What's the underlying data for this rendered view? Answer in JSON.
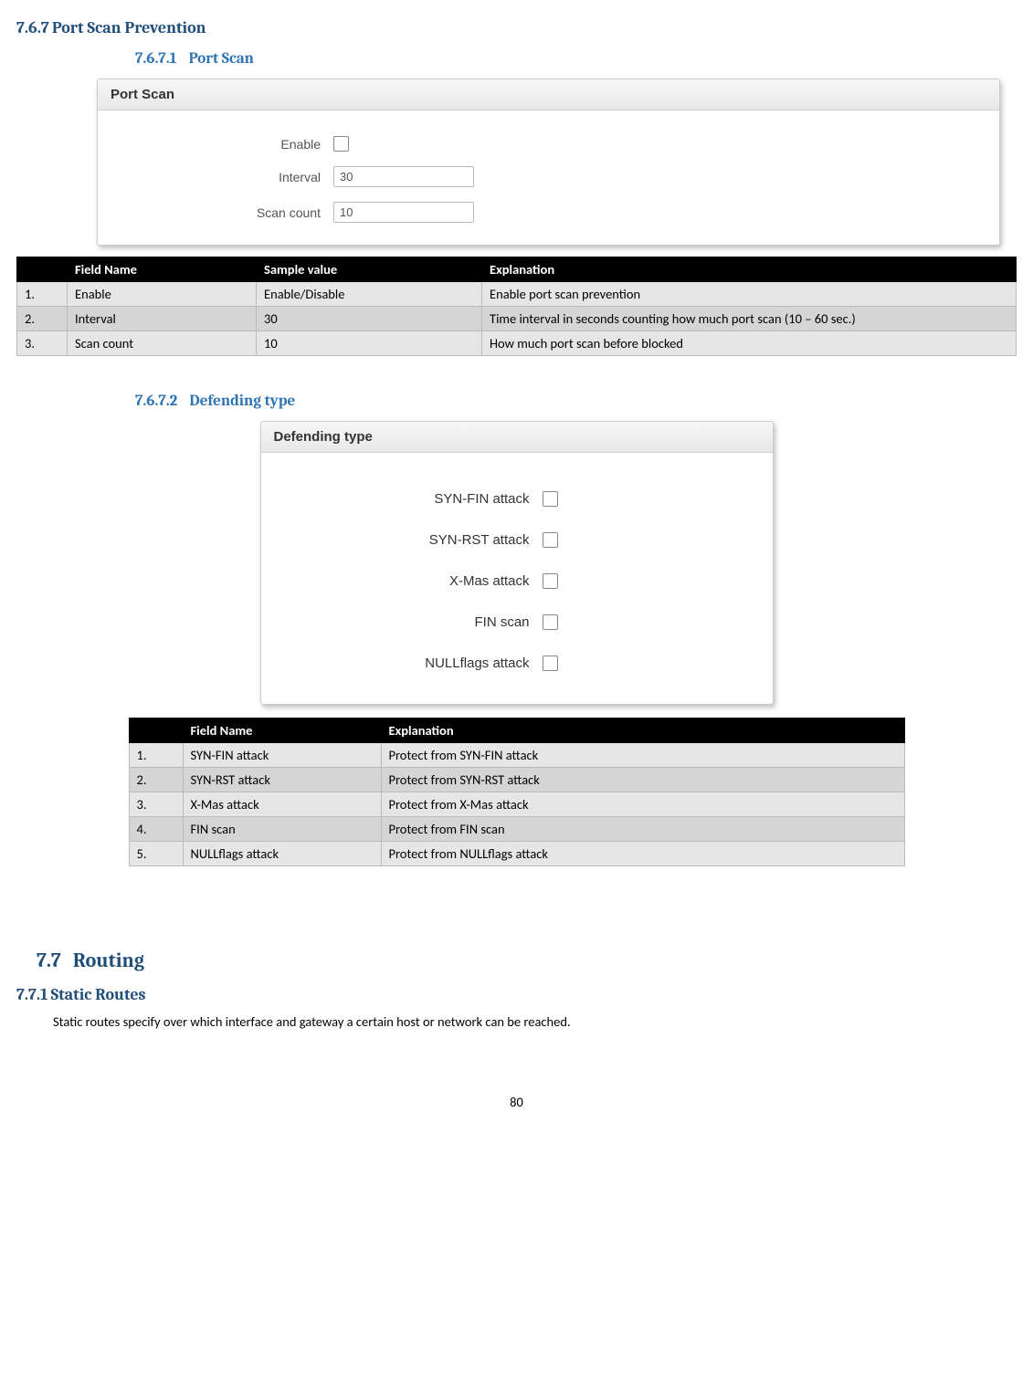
{
  "sections": {
    "s767_num": "7.6.7",
    "s767_title": "Port Scan Prevention",
    "s7671_num": "7.6.7.1",
    "s7671_title": "Port Scan",
    "s7672_num": "7.6.7.2",
    "s7672_title": "Defending type",
    "s77_num": "7.7",
    "s77_title": "Routing",
    "s771_num": "7.7.1",
    "s771_title": "Static Routes"
  },
  "portscan_panel": {
    "title": "Port Scan",
    "enable_label": "Enable",
    "interval_label": "Interval",
    "interval_value": "30",
    "scancount_label": "Scan count",
    "scancount_value": "10"
  },
  "table1": {
    "h_num": "",
    "h_field": "Field Name",
    "h_sample": "Sample value",
    "h_expl": "Explanation",
    "rows": [
      {
        "n": "1.",
        "field": "Enable",
        "sample": "Enable/Disable",
        "expl": "Enable port scan prevention"
      },
      {
        "n": "2.",
        "field": "Interval",
        "sample": "30",
        "expl": "Time interval in seconds counting how much port scan (10 – 60 sec.)"
      },
      {
        "n": "3.",
        "field": "Scan count",
        "sample": "10",
        "expl": "How much port scan before blocked"
      }
    ]
  },
  "deftype_panel": {
    "title": "Defending type",
    "items": [
      "SYN-FIN attack",
      "SYN-RST attack",
      "X-Mas attack",
      "FIN scan",
      "NULLflags attack"
    ]
  },
  "table2": {
    "h_num": "",
    "h_field": "Field Name",
    "h_expl": "Explanation",
    "rows": [
      {
        "n": "1.",
        "field": "SYN-FIN attack",
        "expl": "Protect from SYN-FIN attack"
      },
      {
        "n": "2.",
        "field": "SYN-RST attack",
        "expl": "Protect from SYN-RST attack"
      },
      {
        "n": "3.",
        "field": "X-Mas attack",
        "expl": "Protect from X-Mas attack"
      },
      {
        "n": "4.",
        "field": "FIN scan",
        "expl": "Protect from FIN scan"
      },
      {
        "n": "5.",
        "field": "NULLflags attack",
        "expl": "Protect from NULLflags attack"
      }
    ]
  },
  "body_text": {
    "static_routes": "Static routes specify over which interface and gateway a certain host or network can be reached."
  },
  "page_number": "80"
}
